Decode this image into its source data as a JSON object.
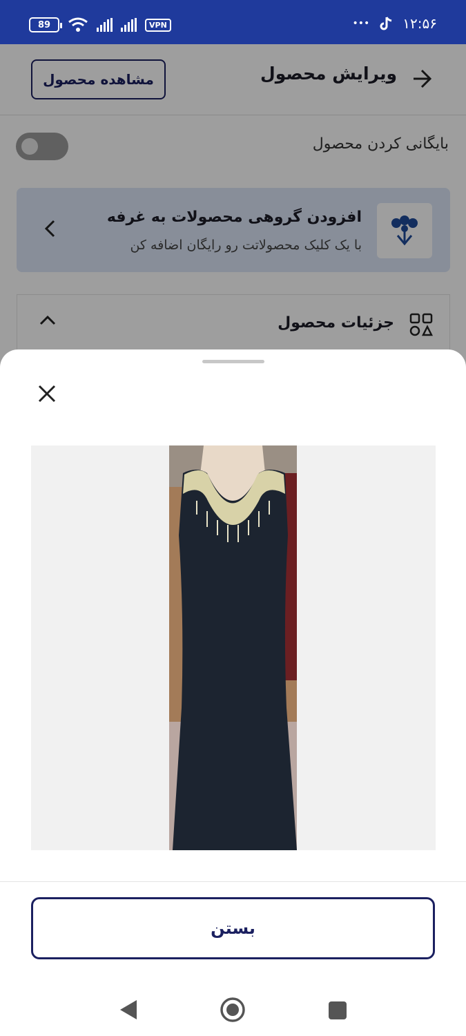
{
  "status_bar": {
    "time": "۱۲:۵۶",
    "battery": "89",
    "vpn": "VPN",
    "dots": "•••"
  },
  "header": {
    "title": "ویرایش محصول",
    "view_button": "مشاهده محصول"
  },
  "archive": {
    "label": "بایگانی کردن محصول",
    "enabled": false
  },
  "group_add": {
    "title": "افزودن گروهی محصولات به غرفه",
    "subtitle": "با یک کلیک محصولاتت رو رایگان اضافه کن"
  },
  "details": {
    "title": "جزئیات محصول"
  },
  "sheet": {
    "close_button": "بستن"
  },
  "colors": {
    "status_bar": "#1f3a9c",
    "accent": "#1b2060",
    "card_bg": "#dbe6f7",
    "icon_blue": "#1f4b9a"
  }
}
